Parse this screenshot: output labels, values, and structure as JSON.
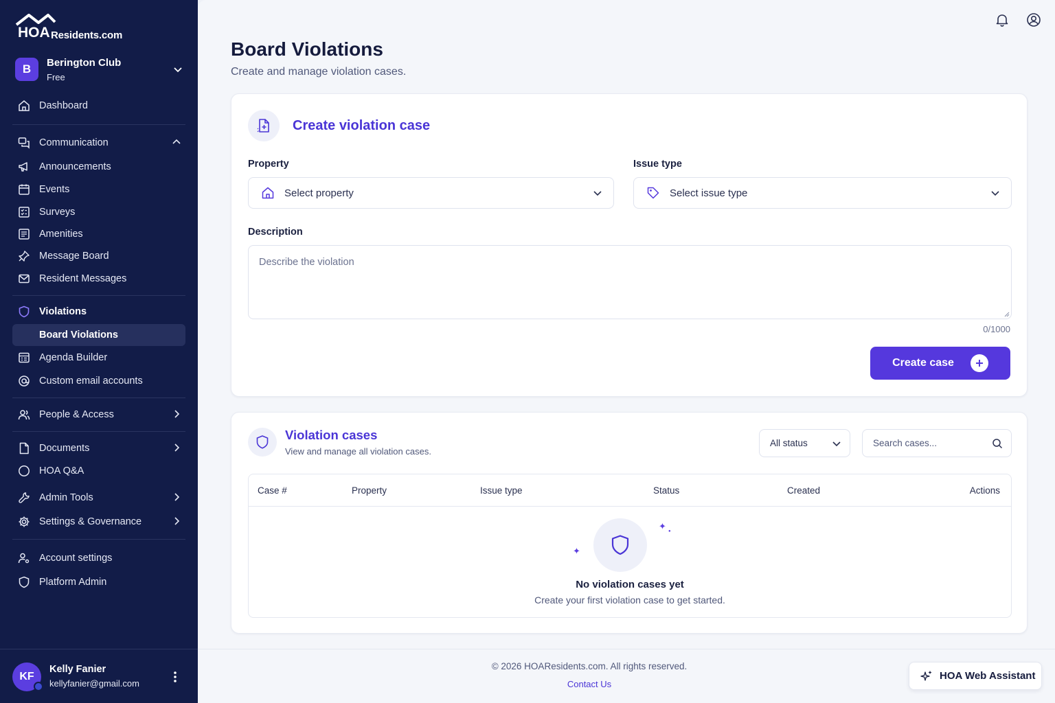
{
  "brand": {
    "logo_text": "Residents.com"
  },
  "org": {
    "initial": "B",
    "name": "Berington Club",
    "plan": "Free"
  },
  "nav": {
    "dashboard": "Dashboard",
    "communication": "Communication",
    "announcements": "Announcements",
    "events": "Events",
    "surveys": "Surveys",
    "amenities": "Amenities",
    "message_board": "Message Board",
    "resident_messages": "Resident Messages",
    "violations": "Violations",
    "board_violations": "Board Violations",
    "agenda_builder": "Agenda Builder",
    "custom_email": "Custom email accounts",
    "people_access": "People & Access",
    "documents": "Documents",
    "hoa_qa": "HOA Q&A",
    "admin_tools": "Admin Tools",
    "settings_governance": "Settings & Governance",
    "account_settings": "Account settings",
    "platform_admin": "Platform Admin"
  },
  "user": {
    "initials": "KF",
    "name": "Kelly Fanier",
    "email": "kellyfanier@gmail.com"
  },
  "page": {
    "title": "Board Violations",
    "subtitle": "Create and manage violation cases."
  },
  "create_form": {
    "title": "Create violation case",
    "property_label": "Property",
    "property_placeholder": "Select property",
    "issue_label": "Issue type",
    "issue_placeholder": "Select issue type",
    "description_label": "Description",
    "description_placeholder": "Describe the violation",
    "counter": "0/1000",
    "submit_label": "Create case"
  },
  "cases": {
    "title": "Violation cases",
    "subtitle": "View and manage all violation cases.",
    "status_filter": "All status",
    "search_placeholder": "Search cases...",
    "columns": [
      "Case #",
      "Property",
      "Issue type",
      "Status",
      "Created",
      "Actions"
    ],
    "empty_title": "No violation cases yet",
    "empty_subtitle": "Create your first violation case to get started."
  },
  "footer": {
    "copyright": "© 2026 HOAResidents.com. All rights reserved.",
    "contact": "Contact Us"
  },
  "assistant": {
    "label": "HOA Web Assistant"
  },
  "colors": {
    "sidebar": "#121c48",
    "accent": "#5538dd",
    "background": "#f4f6fa"
  }
}
